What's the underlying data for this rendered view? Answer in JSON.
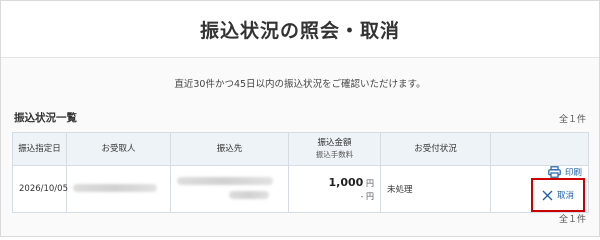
{
  "header": {
    "title": "振込状況の照会・取消"
  },
  "notice": "直近30件かつ45日以内の振込状況をご確認いただけます。",
  "section": {
    "title": "振込状況一覧",
    "count_top": "全１件",
    "count_bottom": "全１件"
  },
  "table": {
    "headers": {
      "date": "振込指定日",
      "recipient": "お受取人",
      "dest": "振込先",
      "amount": "振込金額",
      "fee": "振込手数料",
      "status": "お受付状況"
    },
    "rows": [
      {
        "date": "2026/10/05",
        "amount_value": "1,000",
        "amount_unit": "円",
        "fee_text": "- 円",
        "status": "未処理",
        "print_label": "印刷",
        "cancel_label": "取消"
      }
    ]
  },
  "icons": {
    "print": "printer-icon",
    "cancel": "close-icon"
  },
  "colors": {
    "accent": "#1f5fa8",
    "highlight": "#cc0000",
    "header_bg": "#eef3f8"
  }
}
